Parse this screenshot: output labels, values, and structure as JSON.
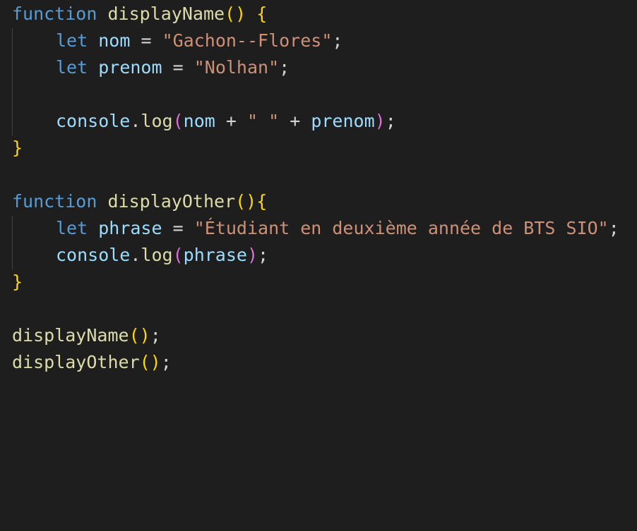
{
  "code": {
    "fn1": {
      "keyword": "function",
      "name": "displayName",
      "parens": "()",
      "brace_open": "{",
      "brace_close": "}",
      "let_nom": {
        "keyword": "let",
        "var": "nom",
        "op": "=",
        "value": "\"Gachon--Flores\"",
        "end": ";"
      },
      "let_prenom": {
        "keyword": "let",
        "var": "prenom",
        "op": "=",
        "value": "\"Nolhan\"",
        "end": ";"
      },
      "log": {
        "object": "console",
        "dot": ".",
        "method": "log",
        "paren_open": "(",
        "arg1": "nom",
        "plus1": "+",
        "space_str": "\" \"",
        "plus2": "+",
        "arg2": "prenom",
        "paren_close": ")",
        "end": ";"
      }
    },
    "fn2": {
      "keyword": "function",
      "name": "displayOther",
      "parens": "()",
      "brace_open": "{",
      "brace_close": "}",
      "let_phrase": {
        "keyword": "let",
        "var": "phrase",
        "op": "=",
        "value": "\"Étudiant en deuxième année de BTS SIO\"",
        "end": ";"
      },
      "log": {
        "object": "console",
        "dot": ".",
        "method": "log",
        "paren_open": "(",
        "arg": "phrase",
        "paren_close": ")",
        "end": ";"
      }
    },
    "call1": {
      "name": "displayName",
      "parens": "()",
      "end": ";"
    },
    "call2": {
      "name": "displayOther",
      "parens": "()",
      "end": ";"
    }
  },
  "colors": {
    "background": "#1e1e1e",
    "keyword": "#569cd6",
    "function": "#dcdcaa",
    "variable": "#9cdcfe",
    "string": "#ce9178",
    "bracket_level1": "#ffd700",
    "bracket_level2": "#da70d6"
  }
}
